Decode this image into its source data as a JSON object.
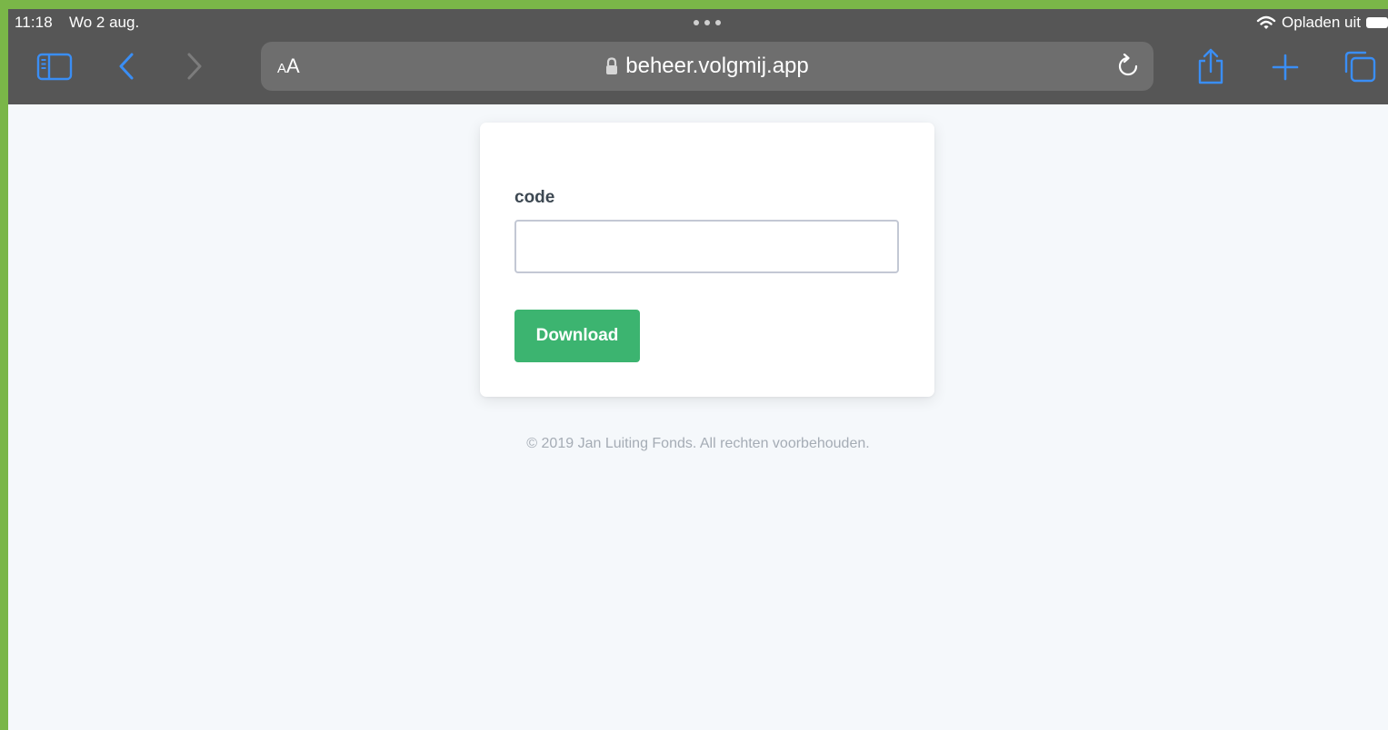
{
  "status_bar": {
    "time": "11:18",
    "date": "Wo 2 aug.",
    "charging_label": "Opladen uit"
  },
  "toolbar": {
    "text_size_label_small": "A",
    "text_size_label_large": "A",
    "url": "beheer.volgmij.app"
  },
  "form": {
    "code_label": "code",
    "code_value": "",
    "download_label": "Download"
  },
  "footer": {
    "copyright": "© 2019 Jan Luiting Fonds. All rechten voorbehouden."
  },
  "colors": {
    "outer_border": "#7ab648",
    "chrome_bg": "#565656",
    "address_bar_bg": "#6e6e6e",
    "accent_blue": "#3a8ef5",
    "button_green": "#3cb470",
    "page_bg": "#f5f8fb"
  },
  "icons": {
    "sidebar": "sidebar-icon",
    "back": "chevron-left-icon",
    "forward": "chevron-right-icon",
    "lock": "lock-icon",
    "reload": "reload-icon",
    "share": "share-icon",
    "new_tab": "plus-icon",
    "tabs": "tabs-icon",
    "wifi": "wifi-icon",
    "battery": "battery-icon",
    "multitask": "more-dots-icon"
  }
}
